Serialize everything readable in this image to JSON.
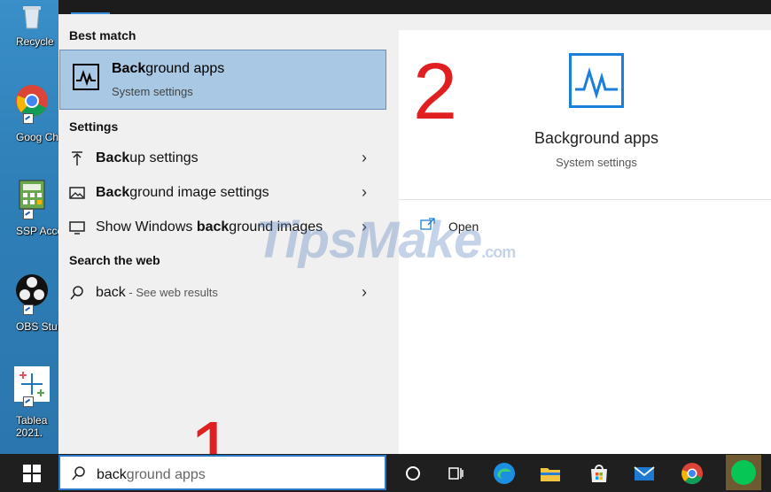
{
  "desktop": {
    "icons": [
      {
        "label": "Recycle"
      },
      {
        "label": "Goog Chron"
      },
      {
        "label": "SSP Accoun"
      },
      {
        "label": "OBS Stu"
      },
      {
        "label": "Tablea 2021."
      }
    ]
  },
  "results": {
    "best_match_label": "Best match",
    "best": {
      "title_bold": "Back",
      "title_rest": "ground apps",
      "subtitle": "System settings"
    },
    "settings_label": "Settings",
    "settings_items": [
      {
        "bold": "Back",
        "rest": "up settings"
      },
      {
        "bold": "Back",
        "rest": "ground image settings"
      },
      {
        "pre": "Show Windows ",
        "bold": "back",
        "rest": "ground images"
      }
    ],
    "web_label": "Search the web",
    "web_item": {
      "query": "back",
      "hint": " - See web results"
    }
  },
  "detail": {
    "title": "Background apps",
    "subtitle": "System settings",
    "open_label": "Open"
  },
  "annotations": {
    "step1": "1",
    "step2": "2"
  },
  "watermark": {
    "text": "TipsMake",
    "suffix": ".com"
  },
  "taskbar": {
    "search_typed": "back",
    "search_suggest": "ground apps",
    "apps": [
      "cortana-icon",
      "task-view-icon",
      "edge-icon",
      "file-explorer-icon",
      "store-icon",
      "mail-icon",
      "chrome-icon",
      "line-icon"
    ]
  },
  "colors": {
    "accent": "#1a7fd8",
    "selection": "#a8c8e4",
    "step": "#e02020"
  }
}
